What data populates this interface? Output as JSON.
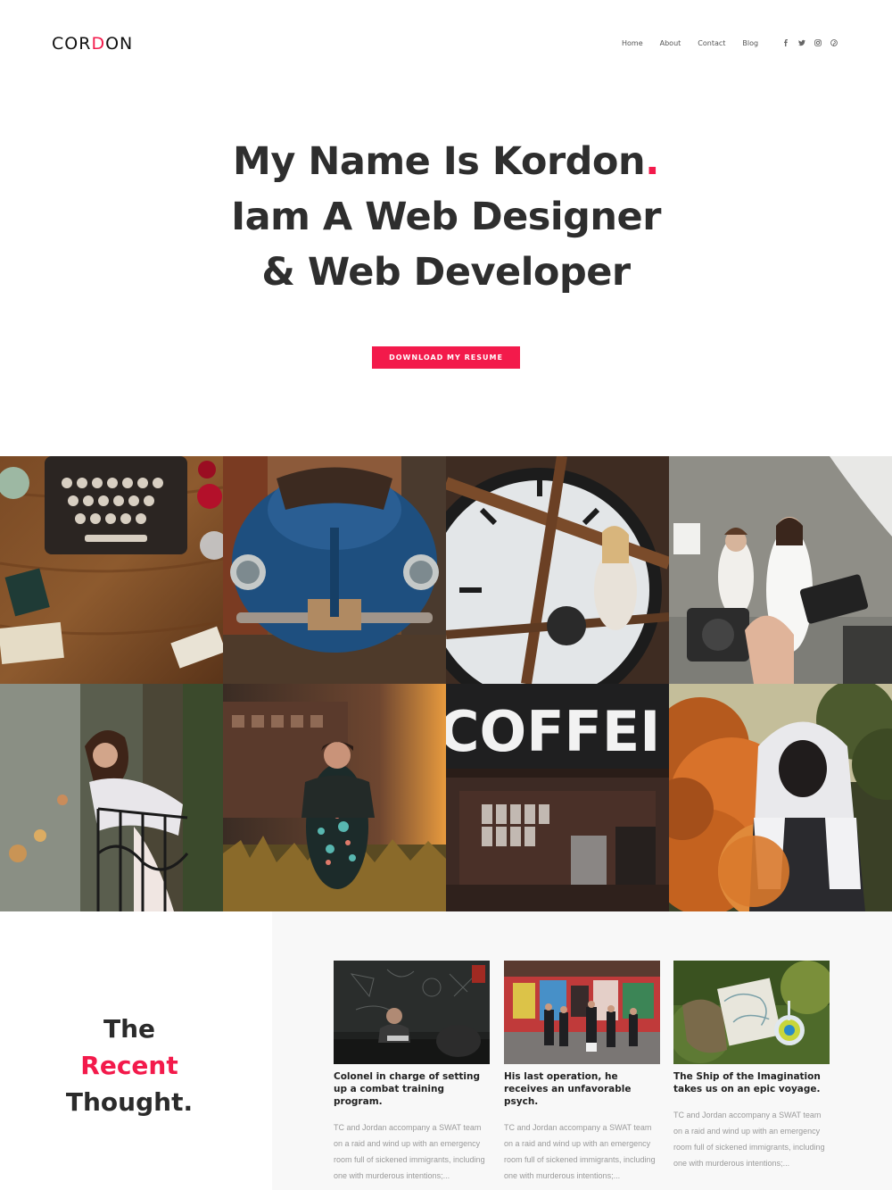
{
  "header": {
    "logo": {
      "part1": "COR",
      "part2": "D",
      "part3": "ON"
    },
    "nav": [
      "Home",
      "About",
      "Contact",
      "Blog"
    ],
    "social": [
      "facebook-icon",
      "twitter-icon",
      "instagram-icon",
      "pinterest-icon"
    ]
  },
  "hero": {
    "line1": "My Name Is Kordon",
    "dot": ".",
    "line2": "Iam A Web Designer",
    "line3": "& Web Developer",
    "button_label": "DOWNLOAD MY RESUME"
  },
  "gallery": {
    "tiles": [
      "typewriter-photo",
      "blue-car-photo",
      "clock-tower-photo",
      "photoshoot-photo",
      "balcony-woman-photo",
      "field-woman-photo",
      "coffee-sign-photo",
      "orange-smoke-photo"
    ],
    "coffee_sign": "COFFEI"
  },
  "recent": {
    "title_line1": "The",
    "title_line2": "Recent",
    "title_line3": "Thought.",
    "posts": [
      {
        "title": "Colonel in charge of setting up a combat training program.",
        "excerpt": "TC and Jordan accompany a SWAT team on a raid and wind up with an emergency room full of sickened immigrants, including one with murderous intentions;..."
      },
      {
        "title": "His last operation, he receives an unfavorable psych.",
        "excerpt": "TC and Jordan accompany a SWAT team on a raid and wind up with an emergency room full of sickened immigrants, including one with murderous intentions;..."
      },
      {
        "title": "The Ship of the Imagination takes us on an epic voyage.",
        "excerpt": "TC and Jordan accompany a SWAT team on a raid and wind up with an emergency room full of sickened immigrants, including one with murderous intentions;..."
      }
    ]
  },
  "colors": {
    "accent": "#f31a4b",
    "text": "#2e2e2e",
    "muted": "#9a9a9a",
    "panel": "#f8f8f8"
  }
}
